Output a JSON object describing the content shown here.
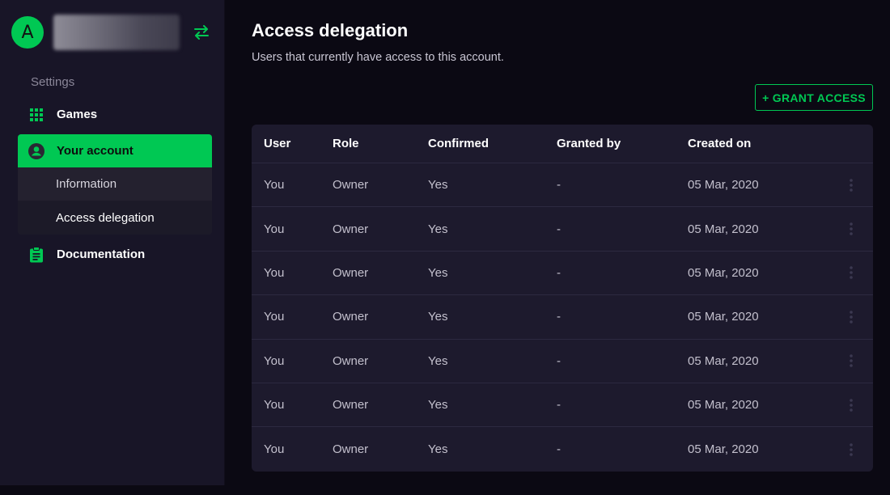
{
  "account": {
    "avatar_letter": "A"
  },
  "sidebar": {
    "section_label": "Settings",
    "items": [
      {
        "label": "Games",
        "icon": "grid-icon"
      },
      {
        "label": "Your account",
        "icon": "account-circle-icon"
      },
      {
        "label": "Documentation",
        "icon": "clipboard-icon"
      }
    ],
    "account_subitems": [
      {
        "label": "Information"
      },
      {
        "label": "Access delegation"
      }
    ]
  },
  "main": {
    "title": "Access delegation",
    "subtitle": "Users that currently have access to this account.",
    "grant_button": "+ GRANT ACCESS",
    "table": {
      "headers": [
        "User",
        "Role",
        "Confirmed",
        "Granted by",
        "Created on"
      ],
      "rows": [
        [
          "You",
          "Owner",
          "Yes",
          "-",
          "05 Mar, 2020"
        ],
        [
          "You",
          "Owner",
          "Yes",
          "-",
          "05 Mar, 2020"
        ],
        [
          "You",
          "Owner",
          "Yes",
          "-",
          "05 Mar, 2020"
        ],
        [
          "You",
          "Owner",
          "Yes",
          "-",
          "05 Mar, 2020"
        ],
        [
          "You",
          "Owner",
          "Yes",
          "-",
          "05 Mar, 2020"
        ],
        [
          "You",
          "Owner",
          "Yes",
          "-",
          "05 Mar, 2020"
        ],
        [
          "You",
          "Owner",
          "Yes",
          "-",
          "05 Mar, 2020"
        ]
      ]
    }
  },
  "colors": {
    "accent": "#00c853",
    "background": "#0b0913",
    "sidebar": "#181527",
    "table": "#1d1a2d"
  }
}
